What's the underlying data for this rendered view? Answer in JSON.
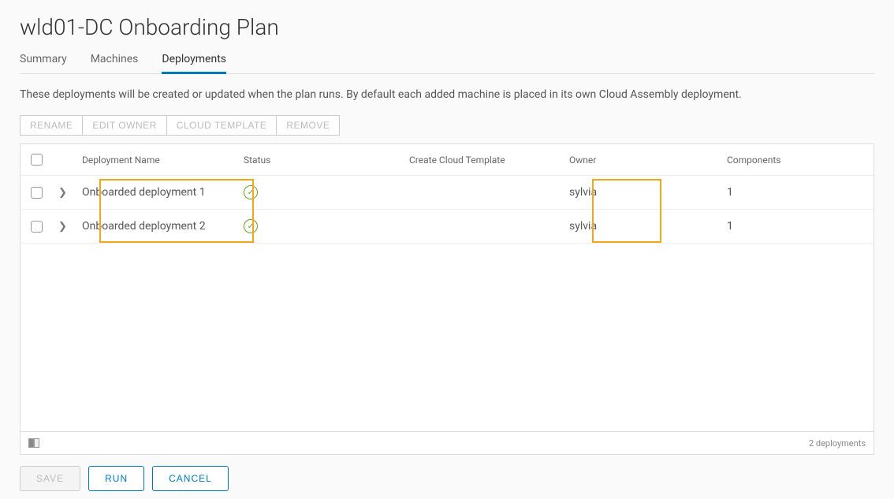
{
  "page": {
    "title": "wld01-DC Onboarding Plan"
  },
  "tabs": [
    {
      "label": "Summary"
    },
    {
      "label": "Machines"
    },
    {
      "label": "Deployments",
      "active": true
    }
  ],
  "description": "These deployments will be created or updated when the plan runs. By default each added machine is placed in its own Cloud Assembly deployment.",
  "toolbar": {
    "rename": "RENAME",
    "edit_owner": "EDIT OWNER",
    "cloud_template": "CLOUD TEMPLATE",
    "remove": "REMOVE"
  },
  "columns": {
    "name": "Deployment Name",
    "status": "Status",
    "template": "Create Cloud Template",
    "owner": "Owner",
    "components": "Components"
  },
  "rows": [
    {
      "name": "Onboarded deployment 1",
      "status": "ok",
      "template": "",
      "owner": "sylvia",
      "components": "1"
    },
    {
      "name": "Onboarded deployment 2",
      "status": "ok",
      "template": "",
      "owner": "sylvia",
      "components": "1"
    }
  ],
  "footer": {
    "count_text": "2 deployments"
  },
  "actions": {
    "save": "SAVE",
    "run": "RUN",
    "cancel": "CANCEL"
  }
}
